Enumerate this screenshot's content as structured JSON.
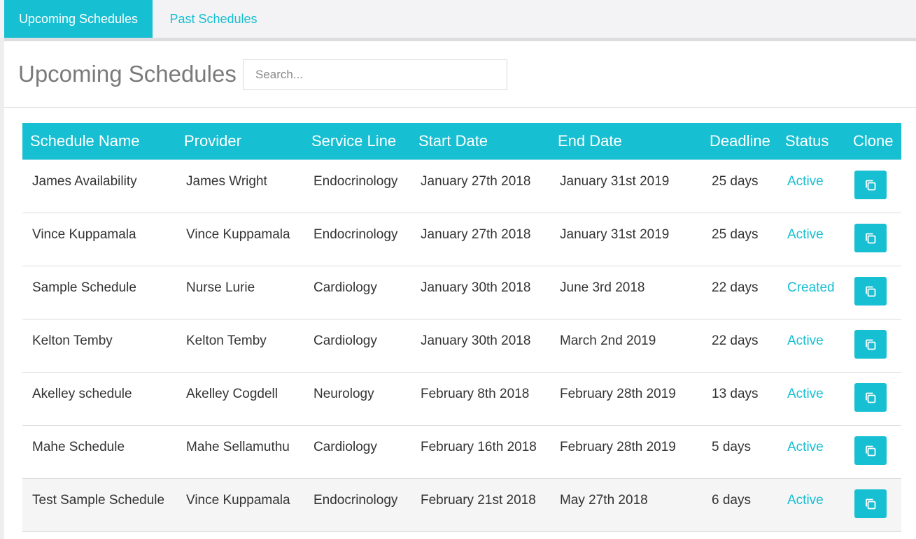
{
  "tabs": [
    {
      "label": "Upcoming Schedules",
      "active": true
    },
    {
      "label": "Past Schedules",
      "active": false
    }
  ],
  "page_title": "Upcoming Schedules",
  "search": {
    "placeholder": "Search...",
    "value": ""
  },
  "table": {
    "columns": [
      "Schedule Name",
      "Provider",
      "Service Line",
      "Start Date",
      "End Date",
      "Deadline",
      "Status",
      "Clone"
    ],
    "rows": [
      {
        "name": "James Availability",
        "provider": "James Wright",
        "service_line": "Endocrinology",
        "start": "January 27th 2018",
        "end": "January 31st 2019",
        "deadline": "25 days",
        "status": "Active"
      },
      {
        "name": "Vince Kuppamala",
        "provider": "Vince Kuppamala",
        "service_line": "Endocrinology",
        "start": "January 27th 2018",
        "end": "January 31st 2019",
        "deadline": "25 days",
        "status": "Active"
      },
      {
        "name": "Sample Schedule",
        "provider": "Nurse Lurie",
        "service_line": "Cardiology",
        "start": "January 30th 2018",
        "end": "June 3rd 2018",
        "deadline": "22 days",
        "status": "Created"
      },
      {
        "name": "Kelton Temby",
        "provider": "Kelton Temby",
        "service_line": "Cardiology",
        "start": "January 30th 2018",
        "end": "March 2nd 2019",
        "deadline": "22 days",
        "status": "Active"
      },
      {
        "name": "Akelley schedule",
        "provider": "Akelley Cogdell",
        "service_line": "Neurology",
        "start": "February 8th 2018",
        "end": "February 28th 2019",
        "deadline": "13 days",
        "status": "Active"
      },
      {
        "name": "Mahe Schedule",
        "provider": "Mahe Sellamuthu",
        "service_line": "Cardiology",
        "start": "February 16th 2018",
        "end": "February 28th 2019",
        "deadline": "5 days",
        "status": "Active"
      },
      {
        "name": "Test Sample Schedule",
        "provider": "Vince Kuppamala",
        "service_line": "Endocrinology",
        "start": "February 21st 2018",
        "end": "May 27th 2018",
        "deadline": "6 days",
        "status": "Active"
      }
    ]
  },
  "colors": {
    "accent": "#17bfd2",
    "background": "#eeeeef",
    "row_hover": "#f5f5f5"
  },
  "icons": {
    "clone": "copy-icon"
  }
}
